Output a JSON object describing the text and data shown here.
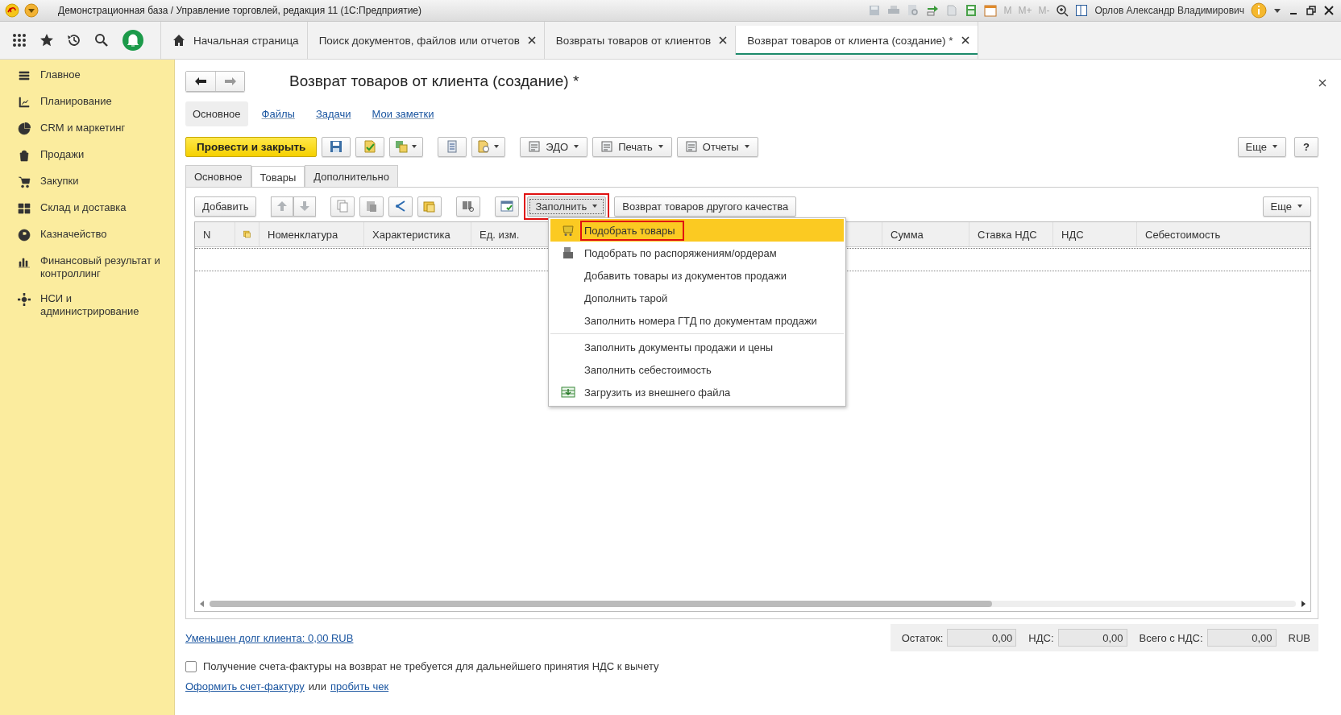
{
  "window": {
    "title": "Демонстрационная база / Управление торговлей, редакция 11  (1С:Предприятие)",
    "user": "Орлов Александр Владимирович",
    "memory_buttons": [
      "M",
      "M+",
      "M-"
    ]
  },
  "nav_tabs": [
    {
      "label": "Начальная страница",
      "selected": false,
      "closable": false
    },
    {
      "label": "Поиск документов, файлов или отчетов",
      "selected": false,
      "closable": true
    },
    {
      "label": "Возвраты товаров от клиентов",
      "selected": false,
      "closable": true
    },
    {
      "label": "Возврат товаров от клиента (создание) *",
      "selected": true,
      "closable": true
    }
  ],
  "sidebar": {
    "items": [
      {
        "label": "Главное"
      },
      {
        "label": "Планирование"
      },
      {
        "label": "CRM и маркетинг"
      },
      {
        "label": "Продажи"
      },
      {
        "label": "Закупки"
      },
      {
        "label": "Склад и доставка"
      },
      {
        "label": "Казначейство"
      },
      {
        "label": "Финансовый результат и контроллинг"
      },
      {
        "label": "НСИ и администрирование"
      }
    ]
  },
  "form": {
    "title": "Возврат товаров от клиента (создание) *",
    "sections": [
      {
        "label": "Основное",
        "selected": true
      },
      {
        "label": "Файлы",
        "selected": false
      },
      {
        "label": "Задачи",
        "selected": false
      },
      {
        "label": "Мои заметки",
        "selected": false
      }
    ],
    "post_button": "Провести и закрыть",
    "commands": [
      "ЭДО",
      "Печать",
      "Отчеты"
    ],
    "more_button": "Еще",
    "help_button": "?",
    "tabs": [
      {
        "label": "Основное",
        "selected": false
      },
      {
        "label": "Товары",
        "selected": true
      },
      {
        "label": "Дополнительно",
        "selected": false
      }
    ],
    "table_toolbar": {
      "add_button": "Добавить",
      "fill_button": {
        "label": "Заполнить",
        "marked": true
      },
      "quality_button": "Возврат товаров другого качества",
      "more_button": "Еще"
    },
    "columns": [
      {
        "kind": "text",
        "label": "N"
      },
      {
        "kind": "icon"
      },
      {
        "kind": "text",
        "label": "Номенклатура"
      },
      {
        "kind": "text",
        "label": "Характеристика"
      },
      {
        "kind": "text",
        "label": "Ед. изм."
      },
      {
        "kind": "blank"
      },
      {
        "kind": "text",
        "label": "Сумма"
      },
      {
        "kind": "text",
        "label": "Ставка НДС"
      },
      {
        "kind": "text",
        "label": "НДС"
      },
      {
        "kind": "text",
        "label": "Себестоимость"
      }
    ],
    "fill_menu": [
      {
        "label": "Подобрать товары",
        "selected": true,
        "marked": true,
        "divider_above": false
      },
      {
        "label": "Подобрать по распоряжениям/ордерам",
        "selected": false,
        "marked": false,
        "divider_above": false
      },
      {
        "label": "Добавить товары из документов продажи",
        "selected": false,
        "marked": false,
        "divider_above": false
      },
      {
        "label": "Дополнить тарой",
        "selected": false,
        "marked": false,
        "divider_above": false
      },
      {
        "label": "Заполнить номера ГТД по документам продажи",
        "selected": false,
        "marked": false,
        "divider_above": false
      },
      {
        "label": "Заполнить документы продажи и цены",
        "selected": false,
        "marked": false,
        "divider_above": true
      },
      {
        "label": "Заполнить себестоимость",
        "selected": false,
        "marked": false,
        "divider_above": false
      },
      {
        "label": "Загрузить из внешнего файла",
        "selected": false,
        "marked": false,
        "divider_above": false
      }
    ],
    "debt_link": "Уменьшен долг клиента: 0,00 RUB",
    "totals": [
      {
        "label": "Остаток:",
        "value": "0,00"
      },
      {
        "label": "НДС:",
        "value": "0,00"
      },
      {
        "label": "Всего с НДС:",
        "value": "0,00"
      }
    ],
    "currency": "RUB",
    "invoice_checkbox": {
      "label": "Получение счета-фактуры на возврат не требуется для дальнейшего принятия НДС к вычету",
      "checked": false
    },
    "invoice_link": "Оформить счет-фактуру",
    "or_text": "или",
    "receipt_link": "пробить чек"
  }
}
